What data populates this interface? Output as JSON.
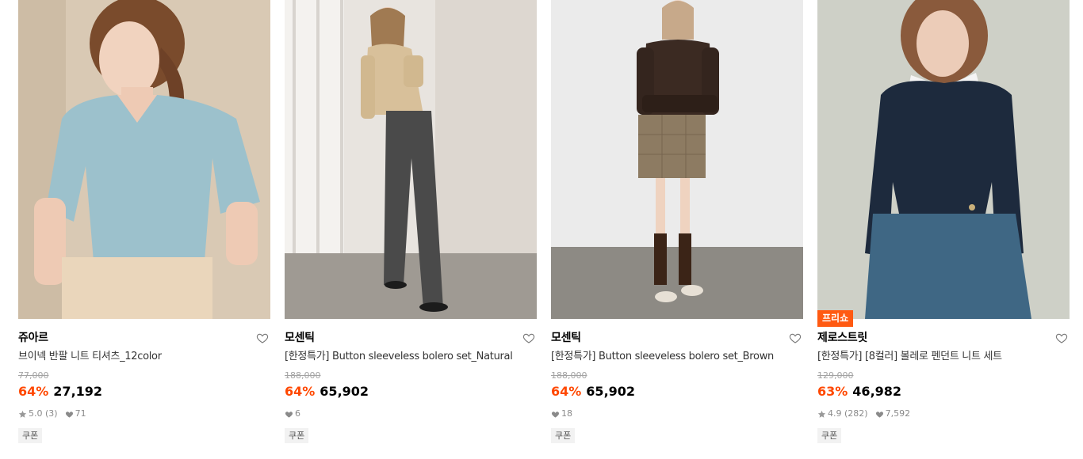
{
  "products": [
    {
      "brand": "쥬아르",
      "title": "브이넥 반팔 니트 티셔츠_12color",
      "original_price": "77,000",
      "discount": "64%",
      "price": "27,192",
      "rating": "5.0",
      "review_count": "(3)",
      "likes": "71",
      "coupon": "쿠폰",
      "badge": "",
      "image_alt": "woman in light blue v-neck short sleeve knit and beige trousers"
    },
    {
      "brand": "모센틱",
      "title": "[한정특가] Button sleeveless bolero set_Natural",
      "original_price": "188,000",
      "discount": "64%",
      "price": "65,902",
      "rating": "",
      "review_count": "",
      "likes": "6",
      "coupon": "쿠폰",
      "badge": "",
      "image_alt": "woman in beige knit bolero and dark wide jeans leaning on wall"
    },
    {
      "brand": "모센틱",
      "title": "[한정특가] Button sleeveless bolero set_Brown",
      "original_price": "188,000",
      "discount": "64%",
      "price": "65,902",
      "rating": "",
      "review_count": "",
      "likes": "18",
      "coupon": "쿠폰",
      "badge": "",
      "image_alt": "woman in brown knit set and check mini skirt"
    },
    {
      "brand": "제로스트릿",
      "title": "[한정특가] [8컬러] 볼레로 펜던트 니트 세트",
      "original_price": "129,000",
      "discount": "63%",
      "price": "46,982",
      "rating": "4.9",
      "review_count": "(282)",
      "likes": "7,592",
      "coupon": "쿠폰",
      "badge": "프리쇼",
      "image_alt": "woman in navy knit bolero set and denim skirt"
    }
  ],
  "colors": {
    "discount": "#ff4800",
    "badge_bg": "#ff5a12",
    "coupon_bg": "#f2f2f2",
    "meta_text": "#8a8a8a"
  },
  "icons": {
    "wishlist": "heart-outline-icon",
    "rating": "star-icon",
    "likes": "heart-filled-icon"
  }
}
